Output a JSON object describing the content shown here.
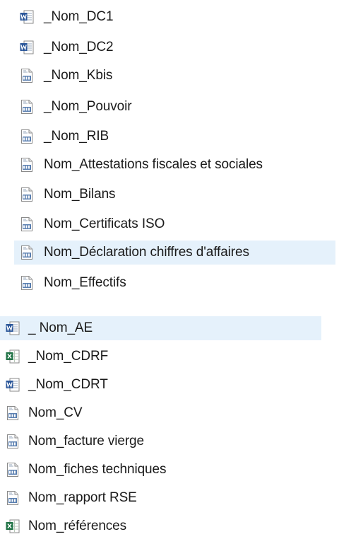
{
  "group1": {
    "items": [
      {
        "name": "_Nom_DC1",
        "type": "word",
        "selected": false
      },
      {
        "name": "_Nom_DC2",
        "type": "word",
        "selected": false
      },
      {
        "name": "_Nom_Kbis",
        "type": "pdf",
        "selected": false
      },
      {
        "name": "_Nom_Pouvoir",
        "type": "pdf",
        "selected": false
      },
      {
        "name": "_Nom_RIB",
        "type": "pdf",
        "selected": false
      },
      {
        "name": "Nom_Attestations fiscales et sociales",
        "type": "pdf",
        "selected": false
      },
      {
        "name": "Nom_Bilans",
        "type": "pdf",
        "selected": false
      },
      {
        "name": "Nom_Certificats ISO",
        "type": "pdf",
        "selected": false
      },
      {
        "name": "Nom_Déclaration chiffres d'affaires",
        "type": "pdf",
        "selected": true
      },
      {
        "name": "Nom_Effectifs",
        "type": "pdf",
        "selected": false
      }
    ]
  },
  "group2": {
    "items": [
      {
        "name": "_ Nom_AE",
        "type": "word",
        "selected": true
      },
      {
        "name": "_Nom_CDRF",
        "type": "excel",
        "selected": false
      },
      {
        "name": "_Nom_CDRT",
        "type": "word",
        "selected": false
      },
      {
        "name": "Nom_CV",
        "type": "pdf",
        "selected": false
      },
      {
        "name": "Nom_facture vierge",
        "type": "pdf",
        "selected": false
      },
      {
        "name": "Nom_fiches techniques",
        "type": "pdf",
        "selected": false
      },
      {
        "name": "Nom_rapport RSE",
        "type": "pdf",
        "selected": false
      },
      {
        "name": "Nom_références",
        "type": "excel",
        "selected": false
      }
    ]
  },
  "colors": {
    "selection": "#e5f1fb",
    "word": "#2b579a",
    "excel": "#217346",
    "pdf_badge": "#5a7fb0"
  }
}
